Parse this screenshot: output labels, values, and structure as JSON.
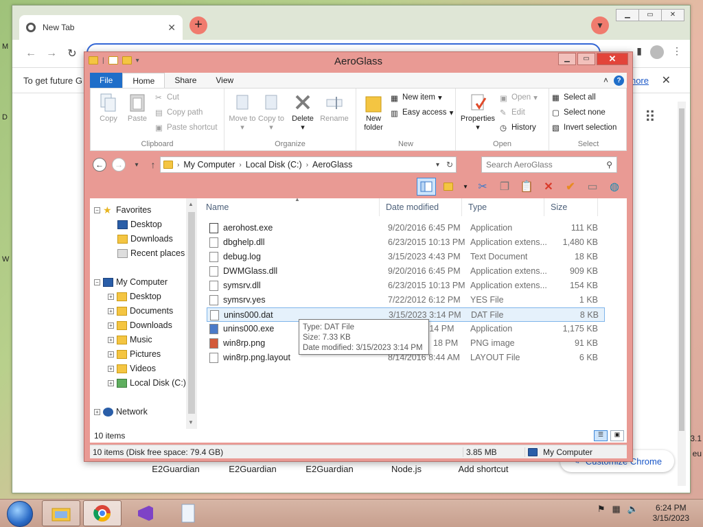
{
  "chrome": {
    "tab_title": "New Tab",
    "infobar_text": "To get future G",
    "infobar_link": "more",
    "shortcuts": [
      "E2Guardian",
      "E2Guardian",
      "E2Guardian",
      "Node.js",
      "Add shortcut"
    ],
    "customize_label": "Customize Chrome"
  },
  "desktop": {
    "left_letters": [
      "M",
      "D",
      "W"
    ],
    "right_text": [
      "3.1",
      "eu"
    ]
  },
  "explorer": {
    "title": "AeroGlass",
    "ribbon_tabs": [
      "File",
      "Home",
      "Share",
      "View"
    ],
    "groups": {
      "clipboard": {
        "label": "Clipboard",
        "copy": "Copy",
        "paste": "Paste",
        "cut": "Cut",
        "copy_path": "Copy path",
        "paste_shortcut": "Paste shortcut"
      },
      "organize": {
        "label": "Organize",
        "move_to": "Move to",
        "copy_to": "Copy to",
        "delete": "Delete",
        "rename": "Rename"
      },
      "new": {
        "label": "New",
        "new_folder": "New folder",
        "new_item": "New item",
        "easy_access": "Easy access"
      },
      "open": {
        "label": "Open",
        "properties": "Properties",
        "open": "Open",
        "edit": "Edit",
        "history": "History"
      },
      "select": {
        "label": "Select",
        "select_all": "Select all",
        "select_none": "Select none",
        "invert_selection": "Invert selection"
      }
    },
    "address": [
      "My Computer",
      "Local Disk (C:)",
      "AeroGlass"
    ],
    "search_placeholder": "Search AeroGlass",
    "tree": {
      "favorites": "Favorites",
      "fav_items": [
        "Desktop",
        "Downloads",
        "Recent places"
      ],
      "computer": "My Computer",
      "computer_items": [
        "Desktop",
        "Documents",
        "Downloads",
        "Music",
        "Pictures",
        "Videos",
        "Local Disk (C:)"
      ],
      "network": "Network"
    },
    "columns": [
      "Name",
      "Date modified",
      "Type",
      "Size"
    ],
    "files": [
      {
        "name": "aerohost.exe",
        "date": "9/20/2016 6:45 PM",
        "type": "Application",
        "size": "111 KB"
      },
      {
        "name": "dbghelp.dll",
        "date": "6/23/2015 10:13 PM",
        "type": "Application extens...",
        "size": "1,480 KB"
      },
      {
        "name": "debug.log",
        "date": "3/15/2023 4:43 PM",
        "type": "Text Document",
        "size": "18 KB"
      },
      {
        "name": "DWMGlass.dll",
        "date": "9/20/2016 6:45 PM",
        "type": "Application extens...",
        "size": "909 KB"
      },
      {
        "name": "symsrv.dll",
        "date": "6/23/2015 10:13 PM",
        "type": "Application extens...",
        "size": "154 KB"
      },
      {
        "name": "symsrv.yes",
        "date": "7/22/2012 6:12 PM",
        "type": "YES File",
        "size": "1 KB"
      },
      {
        "name": "unins000.dat",
        "date": "3/15/2023 3:14 PM",
        "type": "DAT File",
        "size": "8 KB"
      },
      {
        "name": "unins000.exe",
        "date": "3:14 PM",
        "type": "Application",
        "size": "1,175 KB"
      },
      {
        "name": "win8rp.png",
        "date": "18 PM",
        "type": "PNG image",
        "size": "91 KB"
      },
      {
        "name": "win8rp.png.layout",
        "date": "8/14/2016 8:44 AM",
        "type": "LAYOUT File",
        "size": "6 KB"
      }
    ],
    "tooltip": {
      "type": "Type: DAT File",
      "size": "Size: 7.33 KB",
      "date": "Date modified: 3/15/2023 3:14 PM"
    },
    "status_items": "10 items",
    "status_disk": "10 items (Disk free space: 79.4 GB)",
    "status_size": "3.85 MB",
    "status_location": "My Computer"
  },
  "taskbar": {
    "time": "6:24 PM",
    "date": "3/15/2023"
  }
}
